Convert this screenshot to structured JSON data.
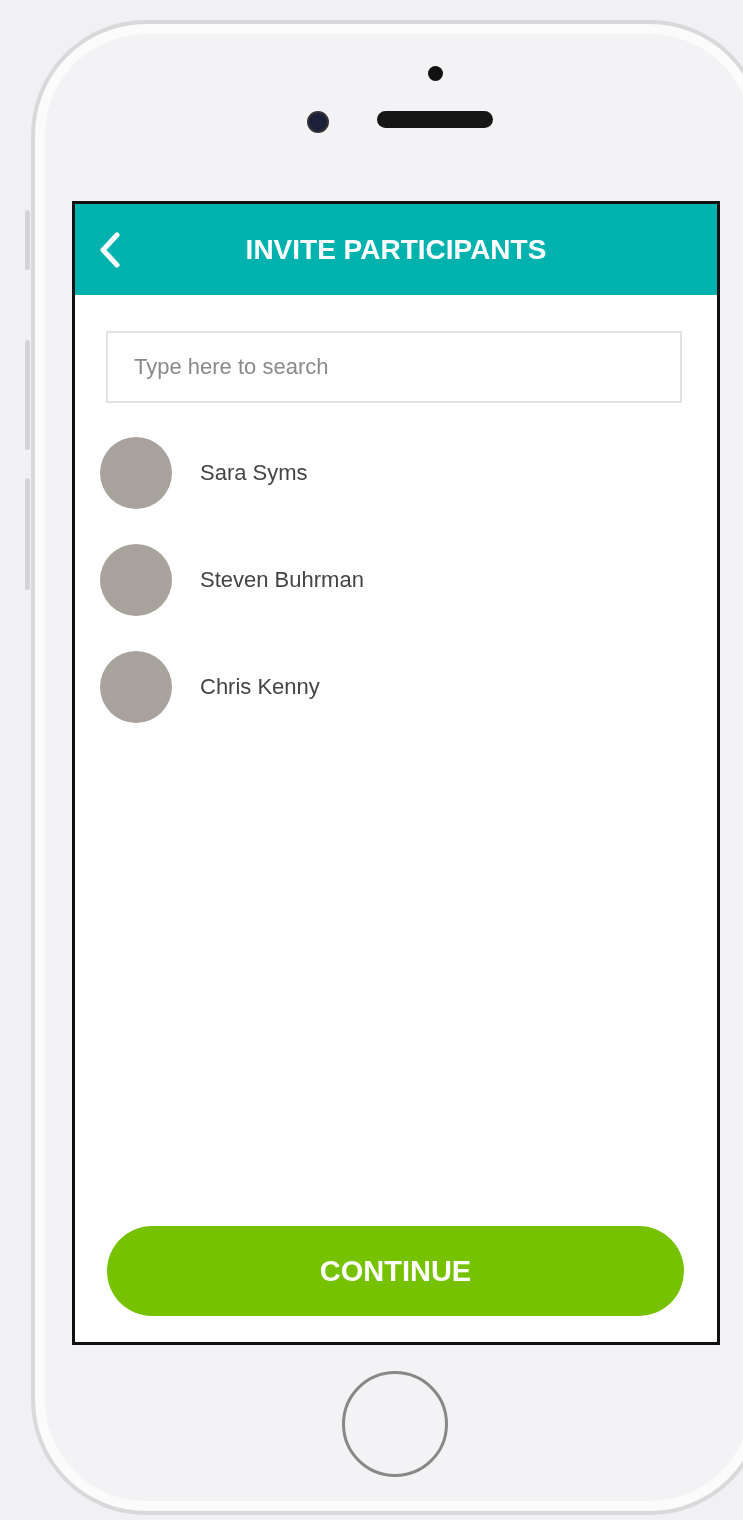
{
  "header": {
    "title": "INVITE PARTICIPANTS"
  },
  "search": {
    "placeholder": "Type here to search"
  },
  "participants": [
    {
      "name": "Sara Syms"
    },
    {
      "name": "Steven Buhrman"
    },
    {
      "name": "Chris Kenny"
    }
  ],
  "continue_button": {
    "label": "CONTINUE"
  }
}
